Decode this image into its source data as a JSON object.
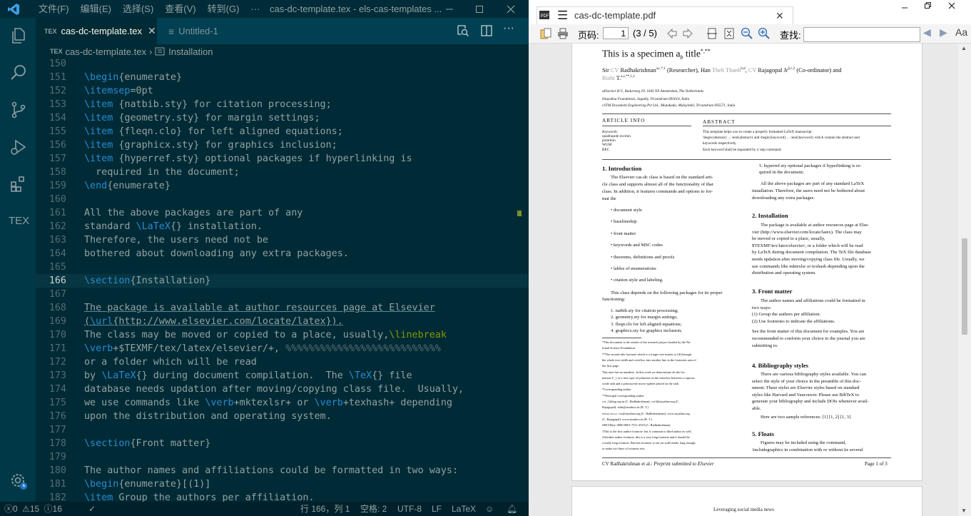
{
  "vscode": {
    "menus": [
      "文件(F)",
      "编辑(E)",
      "选择(S)",
      "查看(V)",
      "转到(G)",
      "···"
    ],
    "window_title": "cas-dc-template.tex - els-cas-templates ...",
    "tabs": [
      {
        "badge": "TEX",
        "label": "cas-dc-template.tex"
      },
      {
        "label": "Untitled-1"
      }
    ],
    "breadcrumb": {
      "file": "cas-dc-template.tex",
      "section": "Installation"
    },
    "activity_icons": [
      "explorer-icon",
      "search-icon",
      "source-control-icon",
      "run-debug-icon",
      "extensions-icon",
      "tex-icon",
      "settings-gear-icon"
    ],
    "activity_tex_label": "TEX",
    "lines": [
      {
        "n": "150",
        "t": ""
      },
      {
        "n": "151",
        "t": "\\begin{enumerate}"
      },
      {
        "n": "152",
        "t": "\\itemsep=0pt"
      },
      {
        "n": "153",
        "t": "\\item {natbib.sty} for citation processing;"
      },
      {
        "n": "154",
        "t": "\\item {geometry.sty} for margin settings;"
      },
      {
        "n": "155",
        "t": "\\item {fleqn.clo} for left aligned equations;"
      },
      {
        "n": "156",
        "t": "\\item {graphicx.sty} for graphics inclusion;"
      },
      {
        "n": "157",
        "t": "\\item {hyperref.sty} optional packages if hyperlinking is"
      },
      {
        "n": "158",
        "t": "  required in the document;"
      },
      {
        "n": "159",
        "t": "\\end{enumerate}"
      },
      {
        "n": "160",
        "t": ""
      },
      {
        "n": "161",
        "t": "All the above packages are part of any"
      },
      {
        "n": "162",
        "t": "standard \\LaTeX{} installation."
      },
      {
        "n": "163",
        "t": "Therefore, the users need not be"
      },
      {
        "n": "164",
        "t": "bothered about downloading any extra packages."
      },
      {
        "n": "165",
        "t": ""
      },
      {
        "n": "166",
        "t": "\\section{Installation}"
      },
      {
        "n": "167",
        "t": ""
      },
      {
        "n": "168",
        "t": "The package is available at author resources page at Elsevier"
      },
      {
        "n": "169",
        "t": "(\\url{http://www.elsevier.com/locate/latex})."
      },
      {
        "n": "170",
        "t": "The class may be moved or copied to a place, usually,\\linebreak"
      },
      {
        "n": "171",
        "t": "\\verb+$TEXMF/tex/latex/elsevier/+, %%%%%%%%%%%%%%%%%%%%%%%%%%%"
      },
      {
        "n": "172",
        "t": "or a folder which will be read"
      },
      {
        "n": "173",
        "t": "by \\LaTeX{} during document compilation.  The \\TeX{} file"
      },
      {
        "n": "174",
        "t": "database needs updation after moving/copying class file.  Usually,"
      },
      {
        "n": "175",
        "t": "we use commands like \\verb+mktexlsr+ or \\verb+texhash+ depending"
      },
      {
        "n": "176",
        "t": "upon the distribution and operating system."
      },
      {
        "n": "177",
        "t": ""
      },
      {
        "n": "178",
        "t": "\\section{Front matter}"
      },
      {
        "n": "179",
        "t": ""
      },
      {
        "n": "180",
        "t": "The author names and affiliations could be formatted in two ways:"
      },
      {
        "n": "181",
        "t": "\\begin{enumerate}[(1)]"
      },
      {
        "n": "182",
        "t": "\\item Group the authors per affiliation."
      }
    ],
    "status": {
      "errors": "0",
      "warnings": "15",
      "infos": "16",
      "position": "行 166，列 1",
      "spaces": "空格: 2",
      "encoding": "UTF-8",
      "eol": "LF",
      "language": "LaTeX"
    },
    "colors": {
      "background": "#002b36",
      "keyword": "#268bd2",
      "comment": "#586e75",
      "linebreak": "#859900"
    }
  },
  "pdf": {
    "tab_title": "cas-dc-template.pdf",
    "page_label": "页码:",
    "page_value": "1",
    "page_count": "(3 / 5)",
    "search_label": "查找:",
    "title": "This is a specimen a",
    "title_sub": "b",
    "title_end": " title",
    "title_marks": "*,**",
    "authors": {
      "p1a": "Sir ",
      "cv1": "CV",
      "p1b": " Radhakrishnan",
      "s1": "a,c,*,1",
      "p1c": " (Researcher),  Han ",
      "gray2": "Theh Thanh",
      "s2": "b,d",
      "p1d": ", ",
      "cv3": "CV",
      "p1e": " Rajagopal Jr",
      "s3": "b,c,2",
      "p1f": " (Co-ordinator) and",
      "gray4": "Rishi",
      "p2": " T.",
      "s4": "a,c,**,1,3"
    },
    "affiliations": [
      "aElsevier B.V., Radarweg 29, 1043 NX Amsterdam, The Netherlands",
      "bSayahna Foundation, Jagathy, Trivandrum 695014, India",
      "cSTM Document Engineering Pvt Ltd., Mepukada, Malayinkil, Trivandrum 695571, India"
    ],
    "article_info": "ARTICLE INFO",
    "keywords_label": "Keywords:",
    "keywords": [
      "quadrupole exciton",
      "polariton",
      "WGM",
      "BEC"
    ],
    "abstract_label": "ABSTRACT",
    "abstract": [
      "This template helps you to create a properly formatted LaTeX manuscript.",
      "\\begin{abstract} ... \\end{abstract} and \\begin{keyword} ... \\end{keyword} which contain the abstract and",
      "keywords respectively.",
      "Each keyword shall be separated by a \\sep command."
    ],
    "left_col": [
      {
        "h": "1.  Introduction"
      },
      {
        "t": "The Elsevier cas-dc class is based on the standard arti-"
      },
      {
        "t": "cle class and supports almost all of the functionality of that"
      },
      {
        "t": "class. In addition, it features commands and options to for-"
      },
      {
        "t": "mat the"
      }
    ],
    "bullets": [
      "document style",
      "baselineskip",
      "front matter",
      "keywords and MSC codes",
      "theorems, definitions and proofs",
      "lables of enumerations",
      "citation style and labeling."
    ],
    "pkg_intro": [
      "This class depends on the following packages for its proper",
      "functioning:"
    ],
    "pkgs": [
      "1.  natbib.sty for citation processing;",
      "2.  geometry.sty for margin settings;",
      "3.  fleqn.clo for left aligned equations;",
      "4.  graphicx.sty for graphics inclusion;"
    ],
    "footnotes": [
      "*This document is the results of the research project funded by the Na-",
      "tional Science Foundation.",
      "**The second title footnote which is a longer text matter to fill through",
      "the whole text width and overflow into another line in the footnotes area of",
      "the first page.",
      "This note has no numbers. In this work we demonstrate ab the for-",
      "mation Y_1 of a new type of polariton on the interface between a cuprous",
      "oxide slab and a polystyrene micro-sphere placed on the slab.",
      "*Corresponding author",
      "**Principal corresponding author",
      "cvr_1@tug.org.in (C. Radhakrishnan); cvr3@sayahna.org (C.",
      "Rajagopal); rishi@stmdocs.in (R. T.)",
      "www.cvr.cc, cvr@sayahna.org (C. Radhakrishnan); www.sayahna.org",
      "(C. Rajagopal); www.stmdocs.in (R. T.)",
      "ORCID(s): 0000-0001-7511-2910 (C. Radhakrishnan)",
      "1This is the first author footnote. but is common to third author as well.",
      "2Another author footnote, this is a very long footnote and it should be",
      "a really long footnote. But this footnote is not yet sufficiently long enough",
      "to make two lines of footnote text."
    ],
    "right_col": [
      "5.  hyperref.sty optional packages if hyperlinking is re-",
      "     quired in the document;",
      "All the above packages are part of any standard LaTeX",
      "installation. Therefore, the users need not be bothered about",
      "downloading any extra packages."
    ],
    "installation": {
      "h": "2.  Installation",
      "lines": [
        "The package is available at author resources page at Else-",
        "vier (http://www.elsevier.com/locate/latex). The class may",
        "be    moved    or    copied    to    a    place,    usually,",
        "$TEXMF/tex/latex/elsevier/, or a folder which will be read",
        "by LaTeX during document compilation. The TeX file database",
        "needs updation after moving/copying class file. Usually, we",
        "use commands like mktexlsr or texhash depending upon the",
        "distribution and operating system."
      ]
    },
    "front_matter": {
      "h": "3.  Front matter",
      "lines": [
        "The author names and affiliations could be formatted in",
        "two ways:",
        "(1)  Group the authors per affiliation.",
        "(2)  Use footnotes to indicate the affiliations.",
        "See the front matter of this document for examples. You are",
        "recommended to conform your choice to the journal you are",
        "submitting to."
      ]
    },
    "bibliography": {
      "h": "4.  Bibliography styles",
      "lines": [
        "There are various bibliography styles available. You can",
        "select the style of your choice in the preamble of this doc-",
        "ument.  These styles are Elsevier styles based on standard",
        "styles like Harvard and Vancouver.  Please use BibTeX to",
        "generate your bibliography and include DOIs whenever avail-",
        "able.",
        "Here are two sample references: [1] [1, 2] [1, 3]"
      ]
    },
    "floats": {
      "h": "5.  Floats",
      "lines": [
        "Figures  may  be  included  using  the  command,",
        "\\includegraphics in combination with or without its several"
      ]
    },
    "footer_left": "CV Radhakrishnan et al.: ",
    "footer_italic": "Preprint submitted to Elsevier",
    "footer_right": "Page 1 of 3",
    "page2_text": "Leveraging social media news"
  }
}
